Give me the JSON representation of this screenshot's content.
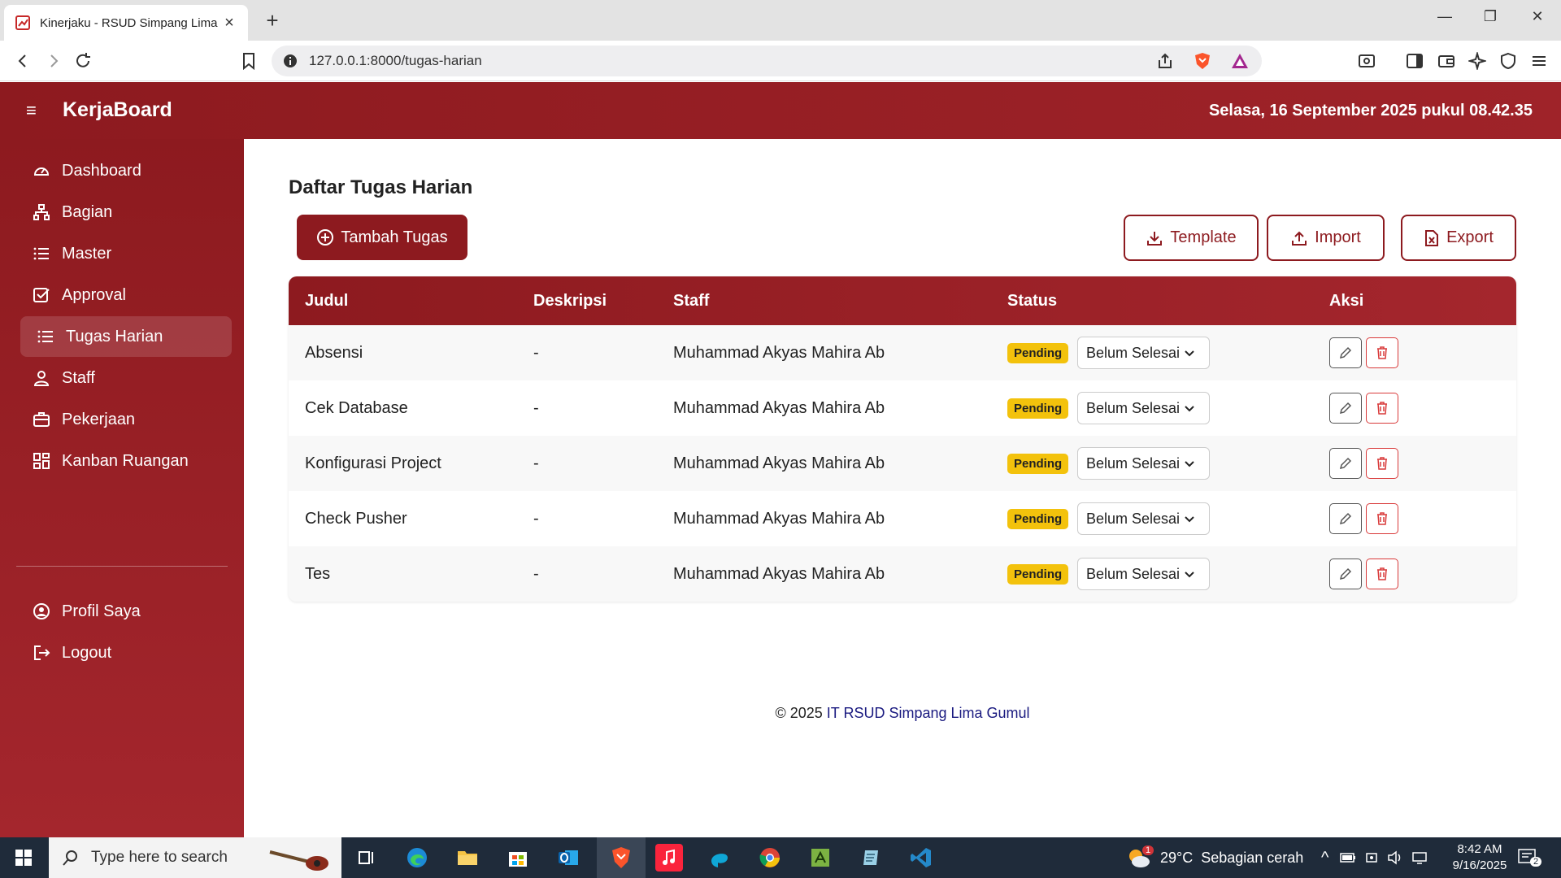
{
  "browser": {
    "tab_title": "Kinerjaku - RSUD Simpang Lima",
    "url": "127.0.0.1:8000/tugas-harian",
    "new_tab": "+",
    "close_tab": "×"
  },
  "header": {
    "brand": "KerjaBoard",
    "datetime": "Selasa, 16 September 2025 pukul 08.42.35"
  },
  "sidebar": {
    "items": [
      {
        "label": "Dashboard",
        "icon": "dashboard-gauge-icon"
      },
      {
        "label": "Bagian",
        "icon": "org-chart-icon"
      },
      {
        "label": "Master",
        "icon": "list-icon"
      },
      {
        "label": "Approval",
        "icon": "check-square-icon"
      },
      {
        "label": "Tugas Harian",
        "icon": "list-icon",
        "active": true
      },
      {
        "label": "Staff",
        "icon": "person-icon"
      },
      {
        "label": "Pekerjaan",
        "icon": "briefcase-icon"
      },
      {
        "label": "Kanban Ruangan",
        "icon": "grid-icon"
      }
    ],
    "bottom_items": [
      {
        "label": "Profil Saya",
        "icon": "user-circle-icon"
      },
      {
        "label": "Logout",
        "icon": "logout-icon"
      }
    ]
  },
  "main": {
    "title": "Daftar Tugas Harian",
    "add_button": "Tambah Tugas",
    "template_button": "Template",
    "import_button": "Import",
    "export_button": "Export",
    "columns": [
      "Judul",
      "Deskripsi",
      "Staff",
      "Status",
      "Aksi"
    ],
    "rows": [
      {
        "judul": "Absensi",
        "deskripsi": "-",
        "staff": "Muhammad Akyas Mahira Ab",
        "badge": "Pending",
        "status": "Belum Selesai"
      },
      {
        "judul": "Cek Database",
        "deskripsi": "-",
        "staff": "Muhammad Akyas Mahira Ab",
        "badge": "Pending",
        "status": "Belum Selesai"
      },
      {
        "judul": "Konfigurasi Project",
        "deskripsi": "-",
        "staff": "Muhammad Akyas Mahira Ab",
        "badge": "Pending",
        "status": "Belum Selesai"
      },
      {
        "judul": "Check Pusher",
        "deskripsi": "-",
        "staff": "Muhammad Akyas Mahira Ab",
        "badge": "Pending",
        "status": "Belum Selesai"
      },
      {
        "judul": "Tes",
        "deskripsi": "-",
        "staff": "Muhammad Akyas Mahira Ab",
        "badge": "Pending",
        "status": "Belum Selesai"
      }
    ]
  },
  "footer": {
    "prefix": "© 2025",
    "org": "IT RSUD Simpang Lima Gumul"
  },
  "taskbar": {
    "search_placeholder": "Type here to search",
    "weather": "29°C  Sebagian cerah",
    "weather_badge": "1",
    "time": "8:42 AM",
    "date": "9/16/2025",
    "notifications": "2"
  },
  "colors": {
    "primary": "#8d1a1f",
    "badge": "#f3c20c",
    "delete": "#d93a3a"
  }
}
